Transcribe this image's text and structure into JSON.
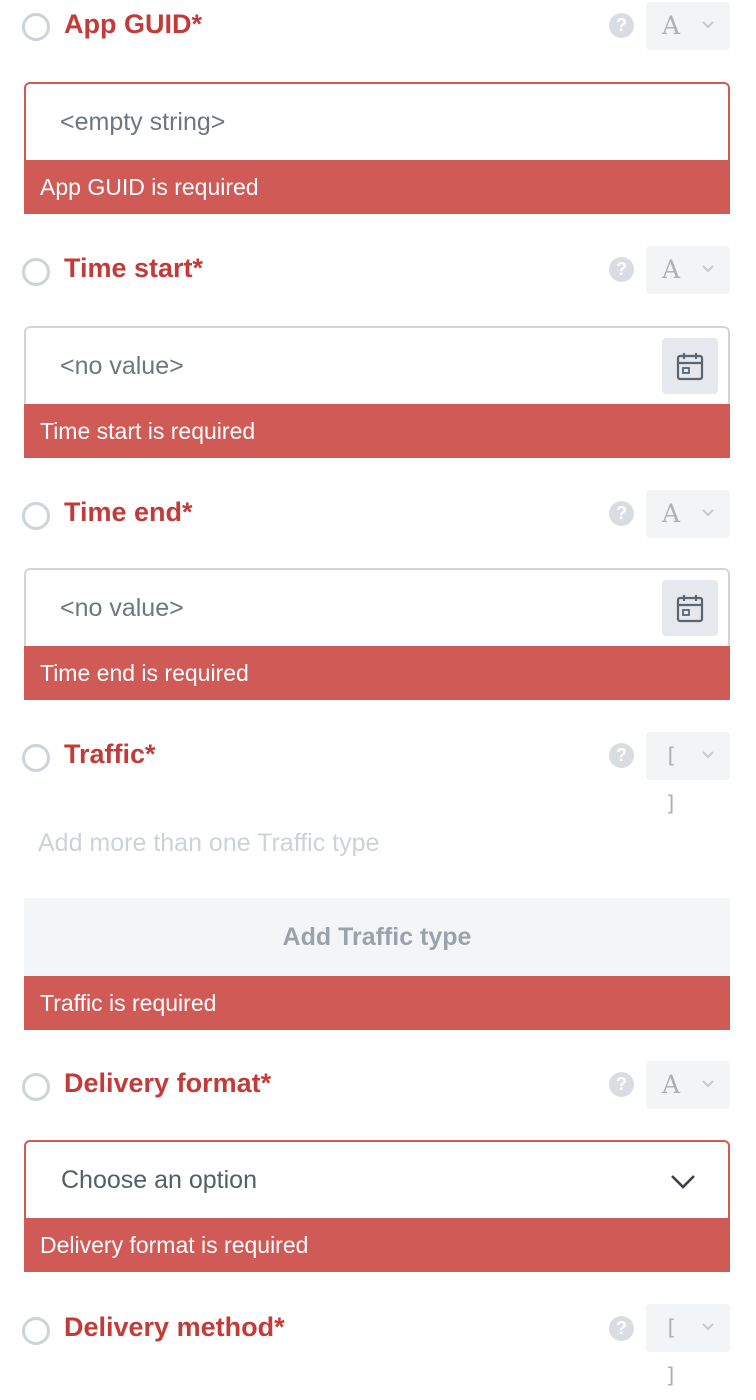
{
  "colors": {
    "label": "#c23b38",
    "error_bar": "#cf5a56",
    "help_icon": "#d8dde2",
    "type_button_bg": "#f2f4f6",
    "calendar_button_bg": "#e5e9ed"
  },
  "fields": {
    "app_guid": {
      "label": "App GUID*",
      "type_glyph": "A",
      "value": "<empty string>",
      "error": "App GUID is required"
    },
    "time_start": {
      "label": "Time start*",
      "type_glyph": "A",
      "value": "<no value>",
      "error": "Time start is required",
      "icon": "calendar-icon"
    },
    "time_end": {
      "label": "Time end*",
      "type_glyph": "A",
      "value": "<no value>",
      "error": "Time end is required",
      "icon": "calendar-icon"
    },
    "traffic": {
      "label": "Traffic*",
      "type_glyph": "[ ]",
      "hint": "Add more than one Traffic type",
      "add_button": "Add Traffic type",
      "error": "Traffic is required"
    },
    "delivery_format": {
      "label": "Delivery format*",
      "type_glyph": "A",
      "selected": "Choose an option",
      "error": "Delivery format is required"
    },
    "delivery_method": {
      "label": "Delivery method*",
      "type_glyph": "[ ]"
    }
  },
  "help_glyph": "?"
}
